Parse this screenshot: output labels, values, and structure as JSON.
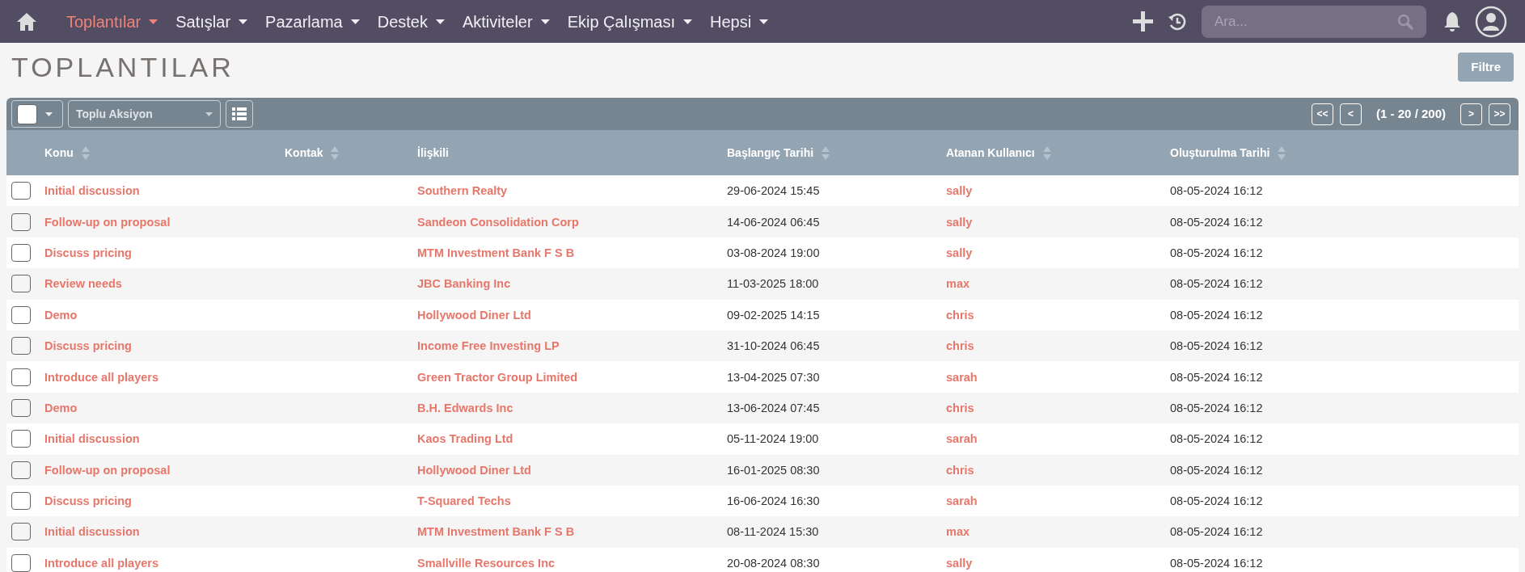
{
  "nav": {
    "items": [
      {
        "label": "Toplantılar",
        "selected": true
      },
      {
        "label": "Satışlar",
        "selected": false
      },
      {
        "label": "Pazarlama",
        "selected": false
      },
      {
        "label": "Destek",
        "selected": false
      },
      {
        "label": "Aktiviteler",
        "selected": false
      },
      {
        "label": "Ekip Çalışması",
        "selected": false
      },
      {
        "label": "Hepsi",
        "selected": false
      }
    ],
    "search": {
      "placeholder": "Ara..."
    }
  },
  "page_title": "TOPLANTILAR",
  "filter_button": "Filtre",
  "toolbar": {
    "bulk_action": "Toplu Aksiyon",
    "select_all_checked": false,
    "pagination": {
      "first": "<<",
      "prev": "<",
      "range": "(1 - 20 / 200)",
      "next": ">",
      "last": ">>"
    }
  },
  "table": {
    "columns": [
      {
        "label": "Konu",
        "sortable": true
      },
      {
        "label": "Kontak",
        "sortable": true
      },
      {
        "label": "İlişkili",
        "sortable": false
      },
      {
        "label": "Başlangıç Tarihi",
        "sortable": true
      },
      {
        "label": "Atanan Kullanıcı",
        "sortable": true
      },
      {
        "label": "Oluşturulma Tarihi",
        "sortable": true
      }
    ],
    "rows": [
      {
        "checked": false,
        "subject": "Initial discussion",
        "contact": "",
        "related": "Southern Realty",
        "start": "29-06-2024 15:45",
        "user": "sally",
        "created": "08-05-2024 16:12"
      },
      {
        "checked": false,
        "subject": "Follow-up on proposal",
        "contact": "",
        "related": "Sandeon Consolidation Corp",
        "start": "14-06-2024 06:45",
        "user": "sally",
        "created": "08-05-2024 16:12"
      },
      {
        "checked": false,
        "subject": "Discuss pricing",
        "contact": "",
        "related": "MTM Investment Bank F S B",
        "start": "03-08-2024 19:00",
        "user": "sally",
        "created": "08-05-2024 16:12"
      },
      {
        "checked": false,
        "subject": "Review needs",
        "contact": "",
        "related": "JBC Banking Inc",
        "start": "11-03-2025 18:00",
        "user": "max",
        "created": "08-05-2024 16:12"
      },
      {
        "checked": false,
        "subject": "Demo",
        "contact": "",
        "related": "Hollywood Diner Ltd",
        "start": "09-02-2025 14:15",
        "user": "chris",
        "created": "08-05-2024 16:12"
      },
      {
        "checked": false,
        "subject": "Discuss pricing",
        "contact": "",
        "related": "Income Free Investing LP",
        "start": "31-10-2024 06:45",
        "user": "chris",
        "created": "08-05-2024 16:12"
      },
      {
        "checked": false,
        "subject": "Introduce all players",
        "contact": "",
        "related": "Green Tractor Group Limited",
        "start": "13-04-2025 07:30",
        "user": "sarah",
        "created": "08-05-2024 16:12"
      },
      {
        "checked": false,
        "subject": "Demo",
        "contact": "",
        "related": "B.H. Edwards Inc",
        "start": "13-06-2024 07:45",
        "user": "chris",
        "created": "08-05-2024 16:12"
      },
      {
        "checked": false,
        "subject": "Initial discussion",
        "contact": "",
        "related": "Kaos Trading Ltd",
        "start": "05-11-2024 19:00",
        "user": "sarah",
        "created": "08-05-2024 16:12"
      },
      {
        "checked": false,
        "subject": "Follow-up on proposal",
        "contact": "",
        "related": "Hollywood Diner Ltd",
        "start": "16-01-2025 08:30",
        "user": "chris",
        "created": "08-05-2024 16:12"
      },
      {
        "checked": false,
        "subject": "Discuss pricing",
        "contact": "",
        "related": "T-Squared Techs",
        "start": "16-06-2024 16:30",
        "user": "sarah",
        "created": "08-05-2024 16:12"
      },
      {
        "checked": false,
        "subject": "Initial discussion",
        "contact": "",
        "related": "MTM Investment Bank F S B",
        "start": "08-11-2024 15:30",
        "user": "max",
        "created": "08-05-2024 16:12"
      },
      {
        "checked": false,
        "subject": "Introduce all players",
        "contact": "",
        "related": "Smallville Resources Inc",
        "start": "20-08-2024 08:30",
        "user": "sally",
        "created": "08-05-2024 16:12"
      }
    ]
  }
}
